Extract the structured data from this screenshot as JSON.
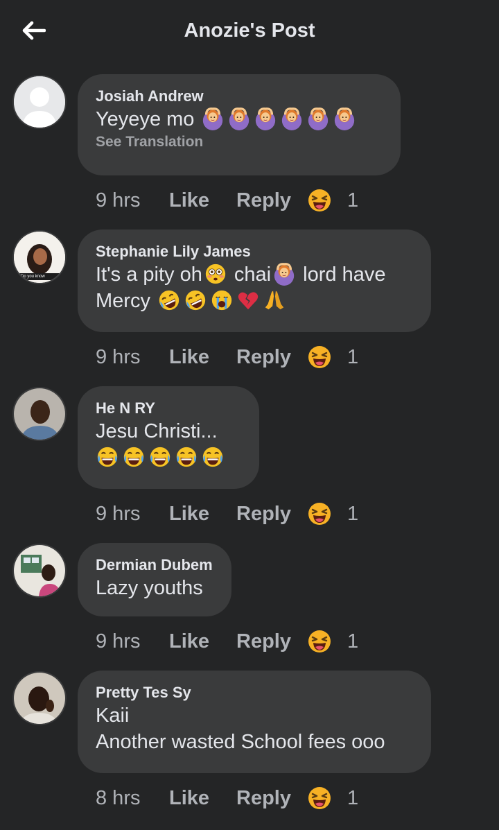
{
  "header": {
    "title": "Anozie's Post",
    "back_icon": "arrow-left-icon"
  },
  "reactions": {
    "icon": "laughing-face-icon"
  },
  "comments": [
    {
      "author": "Josiah Andrew",
      "text": "Yeyeye mo",
      "emojis": [
        "woman-gesturing-ok-icon",
        "woman-gesturing-ok-icon",
        "woman-gesturing-ok-icon",
        "woman-gesturing-ok-icon",
        "woman-gesturing-ok-icon",
        "woman-gesturing-ok-icon"
      ],
      "see_translation": "See Translation",
      "time": "9 hrs",
      "like": "Like",
      "reply": "Reply",
      "reaction_count": "1"
    },
    {
      "author": "Stephanie Lily James",
      "line1_a": "It's a pity oh",
      "line1_b": " chai",
      "line1_c": " lord have",
      "line2": "Mercy ",
      "avatar_text": "Do you know",
      "time": "9 hrs",
      "like": "Like",
      "reply": "Reply",
      "reaction_count": "1"
    },
    {
      "author": "He N RY",
      "text": "Jesu Christi...",
      "time": "9 hrs",
      "like": "Like",
      "reply": "Reply",
      "reaction_count": "1"
    },
    {
      "author": "Dermian Dubem",
      "text": "Lazy youths",
      "time": "9 hrs",
      "like": "Like",
      "reply": "Reply",
      "reaction_count": "1"
    },
    {
      "author": "Pretty Tes Sy",
      "line1": "Kaii",
      "line2": "Another wasted School fees ooo",
      "time": "8 hrs",
      "like": "Like",
      "reply": "Reply",
      "reaction_count": "1"
    }
  ],
  "colors": {
    "background": "#242526",
    "bubble": "#3a3b3c",
    "text": "#e4e6eb",
    "secondary": "#b0b3b8",
    "reaction_yellow": "#f7b125"
  }
}
